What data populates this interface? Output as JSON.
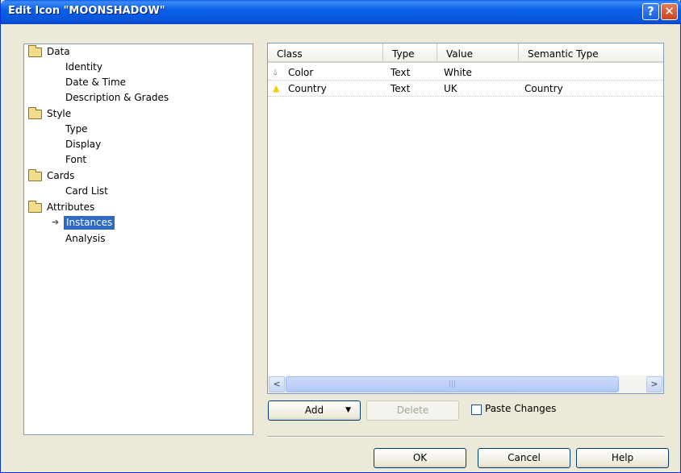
{
  "window": {
    "title": "Edit Icon \"MOONSHADOW\""
  },
  "tree": {
    "items": [
      {
        "label": "Data",
        "type": "folder"
      },
      {
        "label": "Identity",
        "type": "child"
      },
      {
        "label": "Date & Time",
        "type": "child"
      },
      {
        "label": "Description & Grades",
        "type": "child"
      },
      {
        "label": "Style",
        "type": "folder"
      },
      {
        "label": "Type",
        "type": "child"
      },
      {
        "label": "Display",
        "type": "child"
      },
      {
        "label": "Font",
        "type": "child"
      },
      {
        "label": "Cards",
        "type": "folder"
      },
      {
        "label": "Card List",
        "type": "child"
      },
      {
        "label": "Attributes",
        "type": "folder"
      },
      {
        "label": "Instances",
        "type": "child",
        "selected": true
      },
      {
        "label": "Analysis",
        "type": "child"
      }
    ]
  },
  "table": {
    "columns": [
      "Class",
      "Type",
      "Value",
      "Semantic Type"
    ],
    "rows": [
      {
        "icon": "drop-icon",
        "class": "Color",
        "type": "Text",
        "value": "White",
        "semantic": ""
      },
      {
        "icon": "warning-icon",
        "class": "Country",
        "type": "Text",
        "value": "UK",
        "semantic": "Country"
      }
    ]
  },
  "actions": {
    "add": "Add",
    "delete": "Delete",
    "paste": "Paste Changes"
  },
  "footer": {
    "ok": "OK",
    "cancel": "Cancel",
    "help": "Help"
  },
  "colors": {
    "titlebar": "#0a5fe8",
    "selection": "#316ac5",
    "dialog_bg": "#ece9d8"
  }
}
